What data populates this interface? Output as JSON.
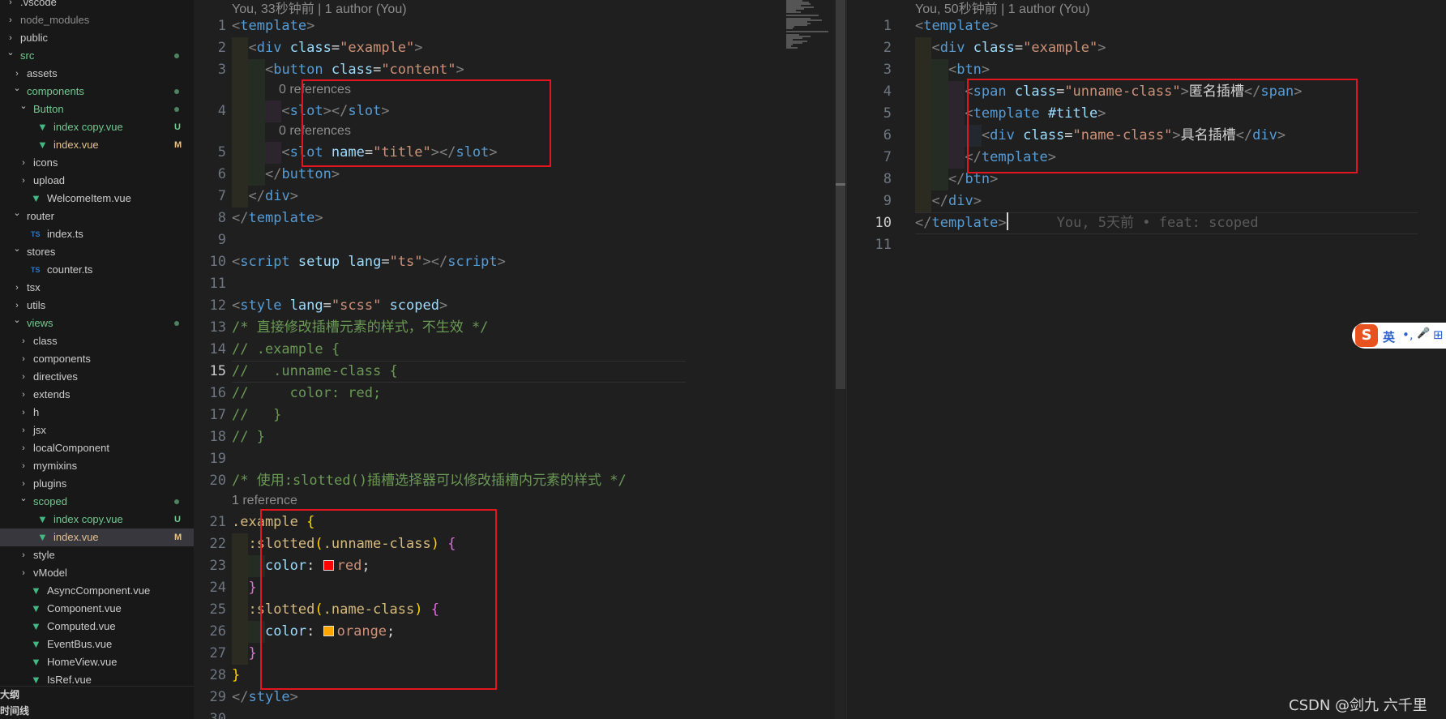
{
  "explorer": {
    "rows": [
      {
        "label": ".vscode",
        "indent": 0,
        "kind": "folder-closed"
      },
      {
        "label": "node_modules",
        "indent": 0,
        "kind": "folder-closed",
        "dim": true
      },
      {
        "label": "public",
        "indent": 0,
        "kind": "folder-closed"
      },
      {
        "label": "src",
        "indent": 0,
        "kind": "folder-open",
        "color": "green",
        "dot": true
      },
      {
        "label": "assets",
        "indent": 1,
        "kind": "folder-closed"
      },
      {
        "label": "components",
        "indent": 1,
        "kind": "folder-open",
        "color": "green",
        "dot": true
      },
      {
        "label": "Button",
        "indent": 2,
        "kind": "folder-open",
        "color": "green",
        "dot": true
      },
      {
        "label": "index copy.vue",
        "indent": 3,
        "kind": "vue",
        "color": "green",
        "badge": "U"
      },
      {
        "label": "index.vue",
        "indent": 3,
        "kind": "vue",
        "color": "yellow",
        "badge": "M"
      },
      {
        "label": "icons",
        "indent": 2,
        "kind": "folder-closed"
      },
      {
        "label": "upload",
        "indent": 2,
        "kind": "folder-closed"
      },
      {
        "label": "WelcomeItem.vue",
        "indent": 2,
        "kind": "vue"
      },
      {
        "label": "router",
        "indent": 1,
        "kind": "folder-open"
      },
      {
        "label": "index.ts",
        "indent": 2,
        "kind": "ts"
      },
      {
        "label": "stores",
        "indent": 1,
        "kind": "folder-open"
      },
      {
        "label": "counter.ts",
        "indent": 2,
        "kind": "ts"
      },
      {
        "label": "tsx",
        "indent": 1,
        "kind": "folder-closed"
      },
      {
        "label": "utils",
        "indent": 1,
        "kind": "folder-closed"
      },
      {
        "label": "views",
        "indent": 1,
        "kind": "folder-open",
        "color": "green",
        "dot": true
      },
      {
        "label": "class",
        "indent": 2,
        "kind": "folder-closed"
      },
      {
        "label": "components",
        "indent": 2,
        "kind": "folder-closed"
      },
      {
        "label": "directives",
        "indent": 2,
        "kind": "folder-closed"
      },
      {
        "label": "extends",
        "indent": 2,
        "kind": "folder-closed"
      },
      {
        "label": "h",
        "indent": 2,
        "kind": "folder-closed"
      },
      {
        "label": "jsx",
        "indent": 2,
        "kind": "folder-closed"
      },
      {
        "label": "localComponent",
        "indent": 2,
        "kind": "folder-closed"
      },
      {
        "label": "mymixins",
        "indent": 2,
        "kind": "folder-closed"
      },
      {
        "label": "plugins",
        "indent": 2,
        "kind": "folder-closed"
      },
      {
        "label": "scoped",
        "indent": 2,
        "kind": "folder-open",
        "color": "green",
        "dot": true
      },
      {
        "label": "index copy.vue",
        "indent": 3,
        "kind": "vue",
        "color": "green",
        "badge": "U"
      },
      {
        "label": "index.vue",
        "indent": 3,
        "kind": "vue",
        "color": "yellow",
        "badge": "M",
        "selected": true
      },
      {
        "label": "style",
        "indent": 2,
        "kind": "folder-closed"
      },
      {
        "label": "vModel",
        "indent": 2,
        "kind": "folder-closed"
      },
      {
        "label": "AsyncComponent.vue",
        "indent": 2,
        "kind": "vue"
      },
      {
        "label": "Component.vue",
        "indent": 2,
        "kind": "vue"
      },
      {
        "label": "Computed.vue",
        "indent": 2,
        "kind": "vue"
      },
      {
        "label": "EventBus.vue",
        "indent": 2,
        "kind": "vue"
      },
      {
        "label": "HomeView.vue",
        "indent": 2,
        "kind": "vue"
      },
      {
        "label": "IsRef.vue",
        "indent": 2,
        "kind": "vue"
      }
    ],
    "ts_icon_text": "TS",
    "vue_icon_text": "▼",
    "panels": [
      "大纲",
      "时间线"
    ]
  },
  "left_editor": {
    "blame": "You, 33秒钟前 | 1 author (You)",
    "active_line": 15,
    "lines": [
      {
        "n": 1,
        "tokens": [
          [
            "br",
            "<"
          ],
          [
            "tag",
            "template"
          ],
          [
            "br",
            ">"
          ]
        ]
      },
      {
        "n": 2,
        "tokens": [
          [
            "txt",
            "  "
          ],
          [
            "br",
            "<"
          ],
          [
            "tag",
            "div"
          ],
          [
            "txt",
            " "
          ],
          [
            "attr",
            "class"
          ],
          [
            "txt",
            "="
          ],
          [
            "str",
            "\"example\""
          ],
          [
            "br",
            ">"
          ]
        ]
      },
      {
        "n": 3,
        "tokens": [
          [
            "txt",
            "    "
          ],
          [
            "br",
            "<"
          ],
          [
            "tag",
            "button"
          ],
          [
            "txt",
            " "
          ],
          [
            "attr",
            "class"
          ],
          [
            "txt",
            "="
          ],
          [
            "str",
            "\"content\""
          ],
          [
            "br",
            ">"
          ]
        ]
      },
      {
        "n": 4,
        "lens": "0 references",
        "tokens": [
          [
            "txt",
            "      "
          ],
          [
            "br",
            "<"
          ],
          [
            "tag",
            "slot"
          ],
          [
            "br",
            "></"
          ],
          [
            "tag",
            "slot"
          ],
          [
            "br",
            ">"
          ]
        ]
      },
      {
        "n": 5,
        "lens": "0 references",
        "tokens": [
          [
            "txt",
            "      "
          ],
          [
            "br",
            "<"
          ],
          [
            "tag",
            "slot"
          ],
          [
            "txt",
            " "
          ],
          [
            "attr",
            "name"
          ],
          [
            "txt",
            "="
          ],
          [
            "str",
            "\"title\""
          ],
          [
            "br",
            "></"
          ],
          [
            "tag",
            "slot"
          ],
          [
            "br",
            ">"
          ]
        ]
      },
      {
        "n": 6,
        "tokens": [
          [
            "txt",
            "    "
          ],
          [
            "br",
            "</"
          ],
          [
            "tag",
            "button"
          ],
          [
            "br",
            ">"
          ]
        ]
      },
      {
        "n": 7,
        "tokens": [
          [
            "txt",
            "  "
          ],
          [
            "br",
            "</"
          ],
          [
            "tag",
            "div"
          ],
          [
            "br",
            ">"
          ]
        ]
      },
      {
        "n": 8,
        "tokens": [
          [
            "br",
            "</"
          ],
          [
            "tag",
            "template"
          ],
          [
            "br",
            ">"
          ]
        ]
      },
      {
        "n": 9,
        "tokens": []
      },
      {
        "n": 10,
        "tokens": [
          [
            "br",
            "<"
          ],
          [
            "tag",
            "script"
          ],
          [
            "txt",
            " "
          ],
          [
            "attr",
            "setup"
          ],
          [
            "txt",
            " "
          ],
          [
            "attr",
            "lang"
          ],
          [
            "txt",
            "="
          ],
          [
            "str",
            "\"ts\""
          ],
          [
            "br",
            "></"
          ],
          [
            "tag",
            "script"
          ],
          [
            "br",
            ">"
          ]
        ]
      },
      {
        "n": 11,
        "tokens": []
      },
      {
        "n": 12,
        "tokens": [
          [
            "br",
            "<"
          ],
          [
            "tag",
            "style"
          ],
          [
            "txt",
            " "
          ],
          [
            "attr",
            "lang"
          ],
          [
            "txt",
            "="
          ],
          [
            "str",
            "\"scss\""
          ],
          [
            "txt",
            " "
          ],
          [
            "attr",
            "scoped"
          ],
          [
            "br",
            ">"
          ]
        ]
      },
      {
        "n": 13,
        "tokens": [
          [
            "cmt",
            "/* 直接修改插槽元素的样式，不生效 */"
          ]
        ]
      },
      {
        "n": 14,
        "tokens": [
          [
            "cmt",
            "// .example {"
          ]
        ]
      },
      {
        "n": 15,
        "tokens": [
          [
            "cmt",
            "//   .unname-class {"
          ]
        ]
      },
      {
        "n": 16,
        "tokens": [
          [
            "cmt",
            "//     color: red;"
          ]
        ]
      },
      {
        "n": 17,
        "tokens": [
          [
            "cmt",
            "//   }"
          ]
        ]
      },
      {
        "n": 18,
        "tokens": [
          [
            "cmt",
            "// }"
          ]
        ]
      },
      {
        "n": 19,
        "tokens": []
      },
      {
        "n": 20,
        "tokens": [
          [
            "cmt",
            "/* 使用:slotted()插槽选择器可以修改插槽内元素的样式 */"
          ]
        ]
      },
      {
        "n": 21,
        "lens": "1 reference",
        "tokens": [
          [
            "sel",
            ".example"
          ],
          [
            "txt",
            " "
          ],
          [
            "brace1",
            "{"
          ]
        ]
      },
      {
        "n": 22,
        "tokens": [
          [
            "txt",
            "  "
          ],
          [
            "sel",
            ":slotted"
          ],
          [
            "brace1",
            "("
          ],
          [
            "sel",
            ".unname-class"
          ],
          [
            "brace1",
            ")"
          ],
          [
            "txt",
            " "
          ],
          [
            "brace2",
            "{"
          ]
        ]
      },
      {
        "n": 23,
        "tokens": [
          [
            "txt",
            "    "
          ],
          [
            "prop",
            "color"
          ],
          [
            "txt",
            ": "
          ],
          [
            "swatch",
            "#ff0000"
          ],
          [
            "str",
            "red"
          ],
          [
            "txt",
            ";"
          ]
        ]
      },
      {
        "n": 24,
        "tokens": [
          [
            "txt",
            "  "
          ],
          [
            "brace2",
            "}"
          ]
        ]
      },
      {
        "n": 25,
        "tokens": [
          [
            "txt",
            "  "
          ],
          [
            "sel",
            ":slotted"
          ],
          [
            "brace1",
            "("
          ],
          [
            "sel",
            ".name-class"
          ],
          [
            "brace1",
            ")"
          ],
          [
            "txt",
            " "
          ],
          [
            "brace2",
            "{"
          ]
        ]
      },
      {
        "n": 26,
        "tokens": [
          [
            "txt",
            "    "
          ],
          [
            "prop",
            "color"
          ],
          [
            "txt",
            ": "
          ],
          [
            "swatch",
            "#ffa500"
          ],
          [
            "str",
            "orange"
          ],
          [
            "txt",
            ";"
          ]
        ]
      },
      {
        "n": 27,
        "tokens": [
          [
            "txt",
            "  "
          ],
          [
            "brace2",
            "}"
          ]
        ]
      },
      {
        "n": 28,
        "tokens": [
          [
            "brace1",
            "}"
          ]
        ]
      },
      {
        "n": 29,
        "tokens": [
          [
            "br",
            "</"
          ],
          [
            "tag",
            "style"
          ],
          [
            "br",
            ">"
          ]
        ]
      },
      {
        "n": 30,
        "tokens": []
      }
    ]
  },
  "right_editor": {
    "blame": "You, 50秒钟前 | 1 author (You)",
    "active_line": 10,
    "lines": [
      {
        "n": 1,
        "tokens": [
          [
            "br",
            "<"
          ],
          [
            "tag",
            "template"
          ],
          [
            "br",
            ">"
          ]
        ]
      },
      {
        "n": 2,
        "tokens": [
          [
            "txt",
            "  "
          ],
          [
            "br",
            "<"
          ],
          [
            "tag",
            "div"
          ],
          [
            "txt",
            " "
          ],
          [
            "attr",
            "class"
          ],
          [
            "txt",
            "="
          ],
          [
            "str",
            "\"example\""
          ],
          [
            "br",
            ">"
          ]
        ]
      },
      {
        "n": 3,
        "tokens": [
          [
            "txt",
            "    "
          ],
          [
            "br",
            "<"
          ],
          [
            "tag",
            "btn"
          ],
          [
            "br",
            ">"
          ]
        ]
      },
      {
        "n": 4,
        "tokens": [
          [
            "txt",
            "      "
          ],
          [
            "br",
            "<"
          ],
          [
            "tag",
            "span"
          ],
          [
            "txt",
            " "
          ],
          [
            "attr",
            "class"
          ],
          [
            "txt",
            "="
          ],
          [
            "str",
            "\"unname-class\""
          ],
          [
            "br",
            ">"
          ],
          [
            "txt",
            "匿名插槽"
          ],
          [
            "br",
            "</"
          ],
          [
            "tag",
            "span"
          ],
          [
            "br",
            ">"
          ]
        ]
      },
      {
        "n": 5,
        "tokens": [
          [
            "txt",
            "      "
          ],
          [
            "br",
            "<"
          ],
          [
            "tag",
            "template"
          ],
          [
            "txt",
            " "
          ],
          [
            "attr",
            "#title"
          ],
          [
            "br",
            ">"
          ]
        ]
      },
      {
        "n": 6,
        "tokens": [
          [
            "txt",
            "        "
          ],
          [
            "br",
            "<"
          ],
          [
            "tag",
            "div"
          ],
          [
            "txt",
            " "
          ],
          [
            "attr",
            "class"
          ],
          [
            "txt",
            "="
          ],
          [
            "str",
            "\"name-class\""
          ],
          [
            "br",
            ">"
          ],
          [
            "txt",
            "具名插槽"
          ],
          [
            "br",
            "</"
          ],
          [
            "tag",
            "div"
          ],
          [
            "br",
            ">"
          ]
        ]
      },
      {
        "n": 7,
        "tokens": [
          [
            "txt",
            "      "
          ],
          [
            "br",
            "</"
          ],
          [
            "tag",
            "template"
          ],
          [
            "br",
            ">"
          ]
        ]
      },
      {
        "n": 8,
        "tokens": [
          [
            "txt",
            "    "
          ],
          [
            "br",
            "</"
          ],
          [
            "tag",
            "btn"
          ],
          [
            "br",
            ">"
          ]
        ]
      },
      {
        "n": 9,
        "tokens": [
          [
            "txt",
            "  "
          ],
          [
            "br",
            "</"
          ],
          [
            "tag",
            "div"
          ],
          [
            "br",
            ">"
          ]
        ]
      },
      {
        "n": 10,
        "tokens": [
          [
            "br",
            "</"
          ],
          [
            "tag",
            "template"
          ],
          [
            "br",
            ">"
          ],
          [
            "cursor",
            ""
          ]
        ],
        "ghost": "You, 5天前 • feat: scoped"
      },
      {
        "n": 11,
        "tokens": []
      }
    ]
  },
  "ime": {
    "logo": "S",
    "mode": "英",
    "punct": "•,",
    "mic": "🎤",
    "more": "⊞"
  },
  "watermark": "CSDN @剑九 六千里",
  "colors": {
    "annotation_box": "#e3161e",
    "git_untracked": "#73c991",
    "git_modified": "#e2c08d"
  }
}
